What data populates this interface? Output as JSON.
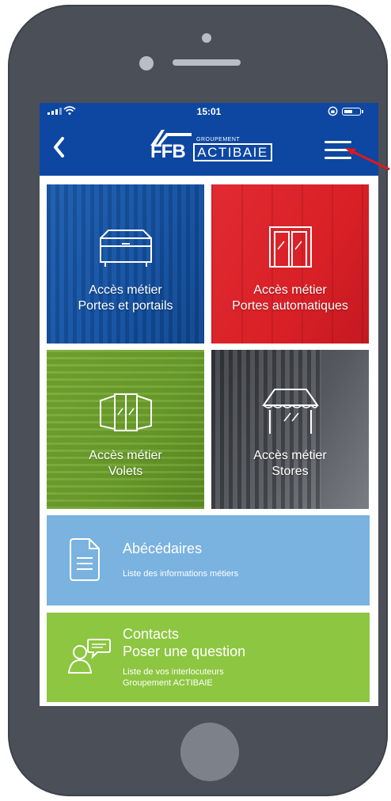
{
  "status_bar": {
    "time": "15:01"
  },
  "nav": {
    "logo_ffb": "FFB",
    "logo_group": "GROUPEMENT",
    "logo_actibaie": "ACTIBAIE"
  },
  "tiles": [
    {
      "line1": "Accès métier",
      "line2": "Portes et portails",
      "color": "#1a56a8"
    },
    {
      "line1": "Accès métier",
      "line2": "Portes automatiques",
      "color": "#d92027"
    },
    {
      "line1": "Accès métier",
      "line2": "Volets",
      "color": "#6b9f2a"
    },
    {
      "line1": "Accès métier",
      "line2": "Stores",
      "color": "#4a4d52"
    }
  ],
  "abecedaires": {
    "title": "Abécédaires",
    "subtitle": "Liste des informations métiers",
    "color": "#7ab2e0"
  },
  "contacts": {
    "title1": "Contacts",
    "title2": "Poser une question",
    "sub1": "Liste de vos interlocuteurs",
    "sub2": "Groupement ACTIBAIE",
    "color": "#8dc641"
  },
  "icons": {
    "back": "chevron-left-icon",
    "menu": "hamburger-menu-icon",
    "doc": "document-icon",
    "chat": "chat-person-icon"
  }
}
